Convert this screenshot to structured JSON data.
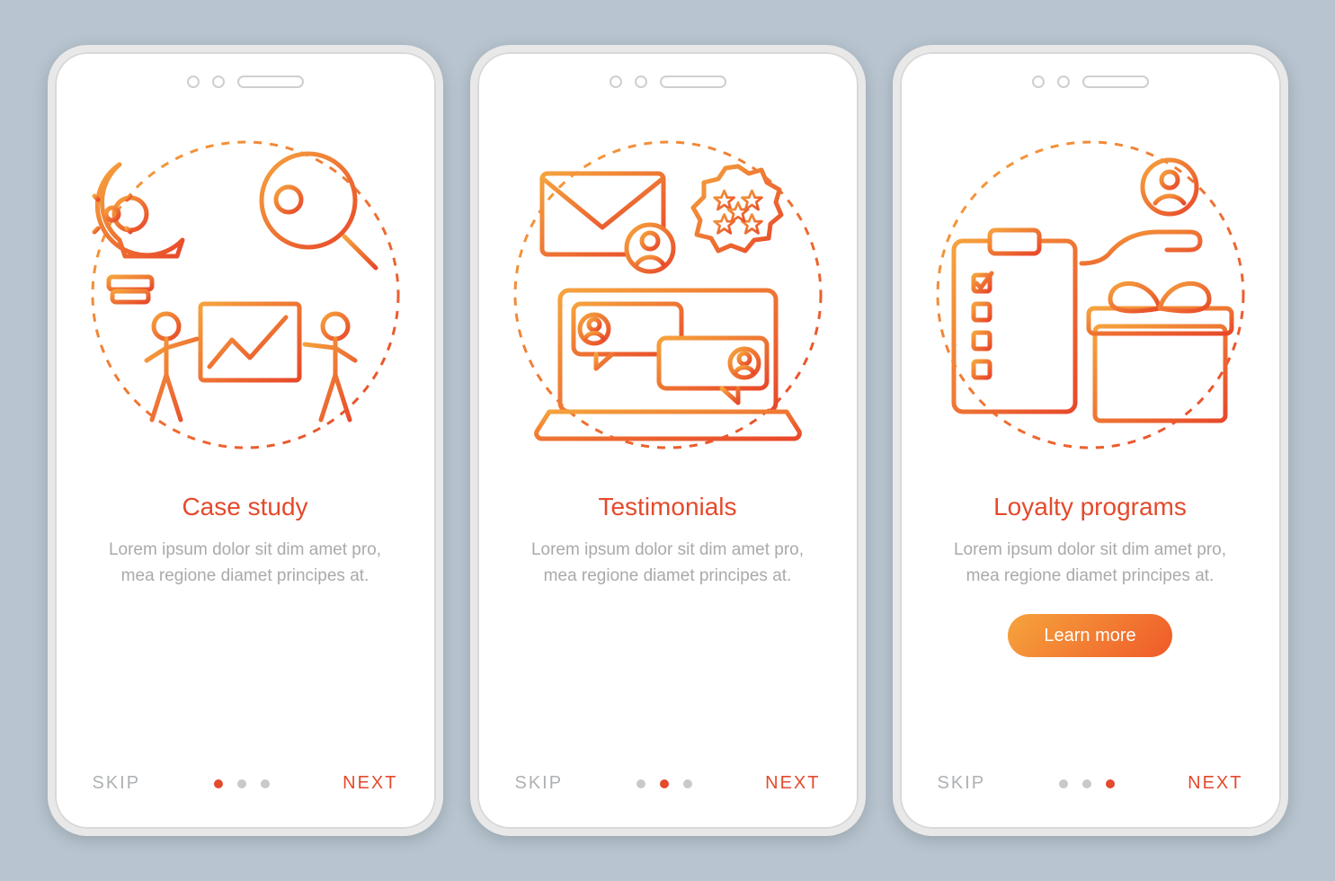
{
  "colors": {
    "accent": "#e44a2c",
    "accentGradStart": "#f6a43c",
    "accentGradEnd": "#ef5a2a",
    "muted": "#a9aaab"
  },
  "screens": [
    {
      "title": "Case study",
      "description": "Lorem ipsum dolor sit dim amet pro, mea regione diamet principes at.",
      "skip": "SKIP",
      "next": "NEXT",
      "activeDot": 0,
      "illustration_icons": [
        "lightbulb-gear-icon",
        "magnifier-key-icon",
        "presentation-people-icon"
      ]
    },
    {
      "title": "Testimonials",
      "description": "Lorem ipsum dolor sit dim amet pro, mea regione diamet principes at.",
      "skip": "SKIP",
      "next": "NEXT",
      "activeDot": 1,
      "illustration_icons": [
        "envelope-avatar-icon",
        "star-badge-icon",
        "laptop-chat-icon"
      ]
    },
    {
      "title": "Loyalty programs",
      "description": "Lorem ipsum dolor sit dim amet pro, mea regione diamet principes at.",
      "skip": "SKIP",
      "next": "NEXT",
      "activeDot": 2,
      "cta": "Learn more",
      "illustration_icons": [
        "hand-avatar-icon",
        "clipboard-checklist-icon",
        "gift-box-icon"
      ]
    }
  ]
}
